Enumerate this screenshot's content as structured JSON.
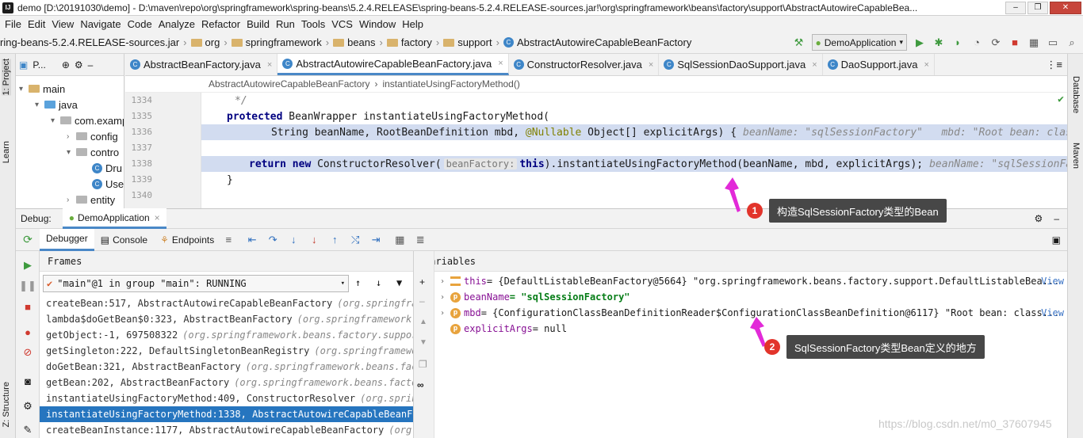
{
  "titlebar": {
    "app_icon": "IJ",
    "title": "demo [D:\\20191030\\demo] - D:\\maven\\repo\\org\\springframework\\spring-beans\\5.2.4.RELEASE\\spring-beans-5.2.4.RELEASE-sources.jar!\\org\\springframework\\beans\\factory\\support\\AbstractAutowireCapableBea...",
    "minimize": "–",
    "maximize": "❐",
    "close": "✕"
  },
  "menu": [
    "File",
    "Edit",
    "View",
    "Navigate",
    "Code",
    "Analyze",
    "Refactor",
    "Build",
    "Run",
    "Tools",
    "VCS",
    "Window",
    "Help"
  ],
  "nav": {
    "crumbs": [
      "ring-beans-5.2.4.RELEASE-sources.jar",
      "org",
      "springframework",
      "beans",
      "factory",
      "support",
      "AbstractAutowireCapableBeanFactory"
    ],
    "run_config": "DemoApplication"
  },
  "left_strip": {
    "project": "1: Project",
    "learn": "Learn",
    "structure": "Z: Structure"
  },
  "right_strip": {
    "database": "Database",
    "maven": "Maven"
  },
  "project": {
    "header": "P...",
    "tree": [
      {
        "label": "main",
        "depth": 0,
        "arrow": "▾",
        "icon": "folder"
      },
      {
        "label": "java",
        "depth": 1,
        "arrow": "▾",
        "icon": "blue-folder"
      },
      {
        "label": "com.examp",
        "depth": 2,
        "arrow": "▾",
        "icon": "package"
      },
      {
        "label": "config",
        "depth": 3,
        "arrow": "›",
        "icon": "package"
      },
      {
        "label": "contro",
        "depth": 3,
        "arrow": "▾",
        "icon": "package"
      },
      {
        "label": "Dru",
        "depth": 4,
        "arrow": "",
        "icon": "class"
      },
      {
        "label": "Use",
        "depth": 4,
        "arrow": "",
        "icon": "class"
      },
      {
        "label": "entity",
        "depth": 3,
        "arrow": "›",
        "icon": "package"
      }
    ]
  },
  "editor": {
    "tabs": [
      {
        "label": "AbstractBeanFactory.java",
        "active": false
      },
      {
        "label": "AbstractAutowireCapableBeanFactory.java",
        "active": true
      },
      {
        "label": "ConstructorResolver.java",
        "active": false
      },
      {
        "label": "SqlSessionDaoSupport.java",
        "active": false
      },
      {
        "label": "DaoSupport.java",
        "active": false
      }
    ],
    "tab_close": "×",
    "tabs_overflow": "⋮≡",
    "crumbs": [
      "AbstractAutowireCapableBeanFactory",
      "instantiateUsingFactoryMethod()"
    ],
    "line_numbers": [
      "1334",
      "1335",
      "1336",
      "1337",
      "1338",
      "1339",
      "1340"
    ],
    "lines": {
      "l1334": "*/",
      "l1335_kw": "protected",
      "l1335_rest": " BeanWrapper instantiateUsingFactoryMethod(",
      "l1336_a": "String beanName, RootBeanDefinition mbd, ",
      "l1336_ann": "@Nullable",
      "l1336_b": " Object[] explicitArgs) {",
      "l1336_dbg": "beanName: \"sqlSessionFactory\"   mbd: \"Root bean: class [null]; scop",
      "l1338_kw1": "return",
      "l1338_kw2": "new",
      "l1338_a": " ConstructorResolver(",
      "l1338_inlay": "beanFactory:",
      "l1338_kw3": "this",
      "l1338_b": ").instantiateUsingFactoryMethod(beanName, mbd, explicitArgs);",
      "l1338_dbg": "beanName: \"sqlSessionFactory\"   mbd:",
      "l1339": "}"
    }
  },
  "debug": {
    "label": "Debug:",
    "session": "DemoApplication",
    "tabs": [
      "Debugger",
      "Console",
      "Endpoints"
    ],
    "frames_header": "Frames",
    "thread": "\"main\"@1 in group \"main\": RUNNING",
    "frames": [
      {
        "method": "createBean:517, AbstractAutowireCapableBeanFactory",
        "pkg": "(org.springframe",
        "selected": false
      },
      {
        "method": "lambda$doGetBean$0:323, AbstractBeanFactory",
        "pkg": "(org.springframework.be",
        "selected": false
      },
      {
        "method": "getObject:-1, 697508322",
        "pkg": "(org.springframework.beans.factory.support",
        "selected": false
      },
      {
        "method": "getSingleton:222, DefaultSingletonBeanRegistry",
        "pkg": "(org.springframewor",
        "selected": false
      },
      {
        "method": "doGetBean:321, AbstractBeanFactory",
        "pkg": "(org.springframework.beans.facto",
        "selected": false
      },
      {
        "method": "getBean:202, AbstractBeanFactory",
        "pkg": "(org.springframework.beans.factor",
        "selected": false
      },
      {
        "method": "instantiateUsingFactoryMethod:409, ConstructorResolver",
        "pkg": "(org.spring",
        "selected": false
      },
      {
        "method": "instantiateUsingFactoryMethod:1338, AbstractAutowireCapableBeanFac",
        "pkg": "",
        "selected": true
      },
      {
        "method": "createBeanInstance:1177, AbstractAutowireCapableBeanFactory",
        "pkg": "(org.s",
        "selected": false
      },
      {
        "method": "doCreateBean:557, AbstractAutowireCapableBeanFactory",
        "pkg": "(org.spring",
        "selected": false
      }
    ],
    "variables_header": "Variables",
    "variables": [
      {
        "exp": "›",
        "icon": "stack",
        "name": "this",
        "value": " = {DefaultListableBeanFactory@5664} \"org.springframework.beans.factory.support.DefaultListableBea...",
        "link": "View"
      },
      {
        "exp": "›",
        "icon": "p",
        "name": "beanName",
        "value": " = \"sqlSessionFactory\"",
        "link": ""
      },
      {
        "exp": "›",
        "icon": "p",
        "name": "mbd",
        "value": " = {ConfigurationClassBeanDefinitionReader$ConfigurationClassBeanDefinition@6117} \"Root bean: class...",
        "link": "View"
      },
      {
        "exp": "",
        "icon": "p",
        "name": "explicitArgs",
        "value": " = null",
        "link": ""
      }
    ]
  },
  "annotations": {
    "badge1": "1",
    "callout1": "构造SqlSessionFactory类型的Bean",
    "badge2": "2",
    "callout2": "SqlSessionFactory类型Bean定义的地方"
  },
  "watermark": "https://blog.csdn.net/m0_37607945",
  "colors": {
    "accent": "#2675bf",
    "highlight": "#d2dcf0",
    "annotation_arrow": "#e22ad8",
    "badge": "#e2342b"
  }
}
